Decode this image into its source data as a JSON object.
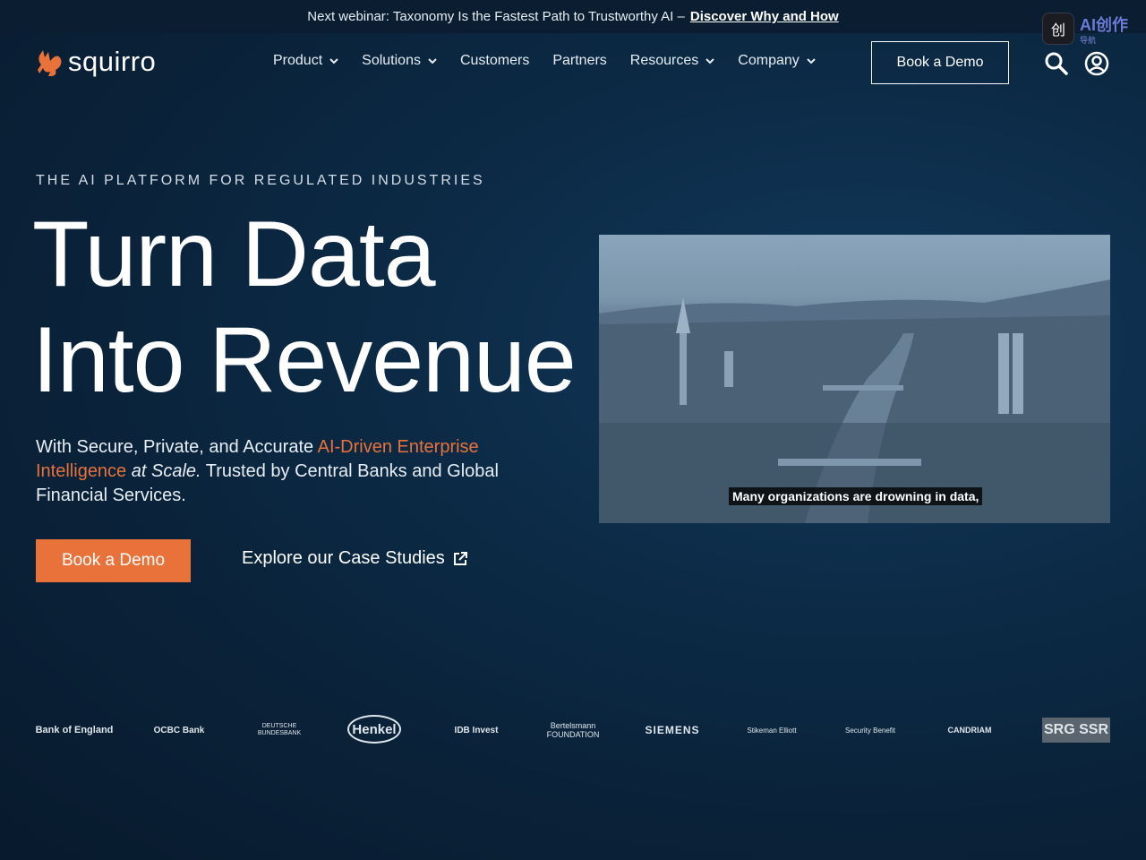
{
  "announcement": {
    "text": "Next webinar: Taxonomy Is the Fastest Path to Trustworthy AI –",
    "link_label": "Discover Why and How"
  },
  "extension": {
    "label": "AI创作",
    "sub_label": "导航",
    "icon_glyph": "创"
  },
  "nav": {
    "logo_text": "squirro",
    "items": [
      {
        "label": "Product",
        "has_dropdown": true
      },
      {
        "label": "Solutions",
        "has_dropdown": true
      },
      {
        "label": "Customers",
        "has_dropdown": false
      },
      {
        "label": "Partners",
        "has_dropdown": false
      },
      {
        "label": "Resources",
        "has_dropdown": true
      },
      {
        "label": "Company",
        "has_dropdown": true
      }
    ],
    "cta_label": "Book a Demo",
    "icons": [
      "search-icon",
      "account-icon"
    ]
  },
  "hero": {
    "eyebrow": "THE AI PLATFORM FOR REGULATED INDUSTRIES",
    "headline_line1": "Turn Data",
    "headline_line2": "Into Revenue",
    "sub_part1": "With Secure, Private, and Accurate ",
    "sub_accent": "AI-Driven Enterprise Intelligence",
    "sub_part2": " ",
    "sub_italic": "at Scale.",
    "sub_part3": " Trusted by Central Banks and Global Financial Services.",
    "primary_cta": "Book a Demo",
    "secondary_cta": "Explore our Case Studies",
    "video_caption": "Many organizations are drowning in data,"
  },
  "customer_logos": [
    "Bank of England",
    "OCBC Bank",
    "DEUTSCHE BUNDESBANK",
    "Henkel",
    "IDB Invest",
    "Bertelsmann FOUNDATION",
    "SIEMENS",
    "Stikeman Elliott",
    "Security Benefit",
    "CANDRIAM",
    "SRG SSR"
  ],
  "colors": {
    "accent": "#e8723a",
    "background": "#0c2b47",
    "announce_bg": "#0b1d30"
  }
}
